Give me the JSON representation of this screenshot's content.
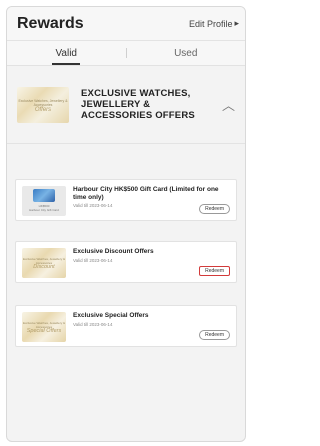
{
  "header": {
    "title": "Rewards",
    "edit_profile": "Edit Profile",
    "edit_profile_icon": "chevron-right-icon"
  },
  "tabs": [
    {
      "label": "Valid",
      "active": true
    },
    {
      "label": "Used",
      "active": false
    }
  ],
  "category": {
    "title": "EXCLUSIVE WATCHES, JEWELLERY & ACCESSORIES OFFERS",
    "thumb_line1": "Exclusive Watches, Jewellery & Accessories",
    "thumb_line2": "Offers",
    "expand_icon": "chevron-up-icon"
  },
  "offers": [
    {
      "name": "Harbour City HK$500 Gift Card (Limited for one time only)",
      "valid": "Valid till 2023-06-14",
      "thumb_line1": "HK$500",
      "thumb_line2": "Harbour City Gift Card",
      "redeem": "Redeem"
    },
    {
      "name": "Exclusive Discount Offers",
      "valid": "Valid till 2023-06-14",
      "thumb_line1": "Exclusive Watches, Jewellery & Accessories",
      "thumb_line2": "Discount",
      "redeem": "Redeem"
    },
    {
      "name": "Exclusive Special Offers",
      "valid": "Valid till 2023-06-14",
      "thumb_line1": "Exclusive Watches, Jewellery & Accessories",
      "thumb_line2": "Special Offers",
      "redeem": "Redeem"
    }
  ],
  "colors": {
    "highlight": "#d23a3a"
  }
}
